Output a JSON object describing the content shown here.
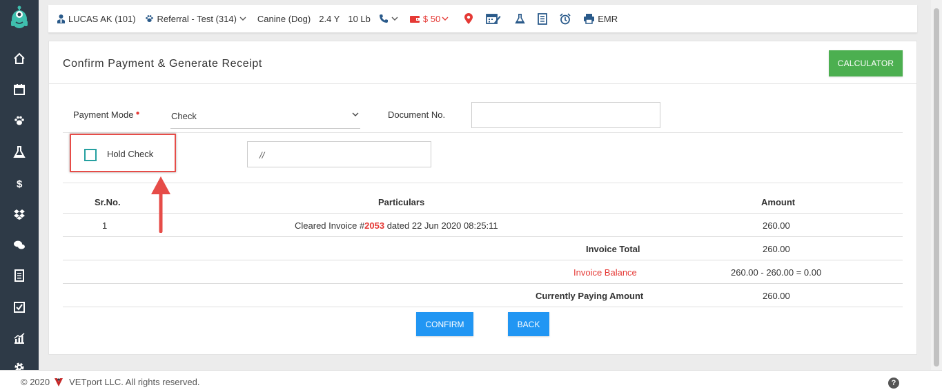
{
  "topbar": {
    "patient": "LUCAS AK (101)",
    "referral": "Referral - Test (314)",
    "species": "Canine (Dog)",
    "age": "2.4 Y",
    "weight": "10 Lb",
    "balance": "$ 50",
    "emr": "EMR"
  },
  "card": {
    "title": "Confirm Payment & Generate Receipt",
    "calculator_label": "CALCULATOR"
  },
  "form": {
    "payment_mode_label": "Payment Mode",
    "payment_mode_value": "Check",
    "document_no_label": "Document No.",
    "document_no_value": "",
    "hold_check_label": "Hold Check",
    "hold_check_checked": false,
    "date_value": "//"
  },
  "table": {
    "headers": {
      "srno": "Sr.No.",
      "particulars": "Particulars",
      "amount": "Amount"
    },
    "rows": [
      {
        "srno": "1",
        "particulars_prefix": "Cleared Invoice #",
        "invoice_no": "2053",
        "particulars_suffix": " dated 22 Jun 2020 08:25:11",
        "amount": "260.00"
      }
    ],
    "invoice_total_label": "Invoice Total",
    "invoice_total_value": "260.00",
    "invoice_balance_label": "Invoice Balance",
    "invoice_balance_value": "260.00 - 260.00 = 0.00",
    "paying_amount_label": "Currently Paying Amount",
    "paying_amount_value": "260.00"
  },
  "buttons": {
    "confirm": "CONFIRM",
    "back": "BACK"
  },
  "footer": {
    "copyright_prefix": "© 2020",
    "company": "VETport LLC. All rights reserved."
  },
  "colors": {
    "sidebar": "#2e3a47",
    "accent_green": "#4caf50",
    "accent_blue": "#2196f3",
    "alert_red": "#e53935",
    "logo_teal": "#3fbfae"
  },
  "sidebar_icons": [
    "home-icon",
    "calendar-icon",
    "paw-icon",
    "flask-icon",
    "dollar-icon",
    "dropbox-icon",
    "chat-icon",
    "receipt-icon",
    "checkbox-icon",
    "chart-icon",
    "gear-icon"
  ]
}
